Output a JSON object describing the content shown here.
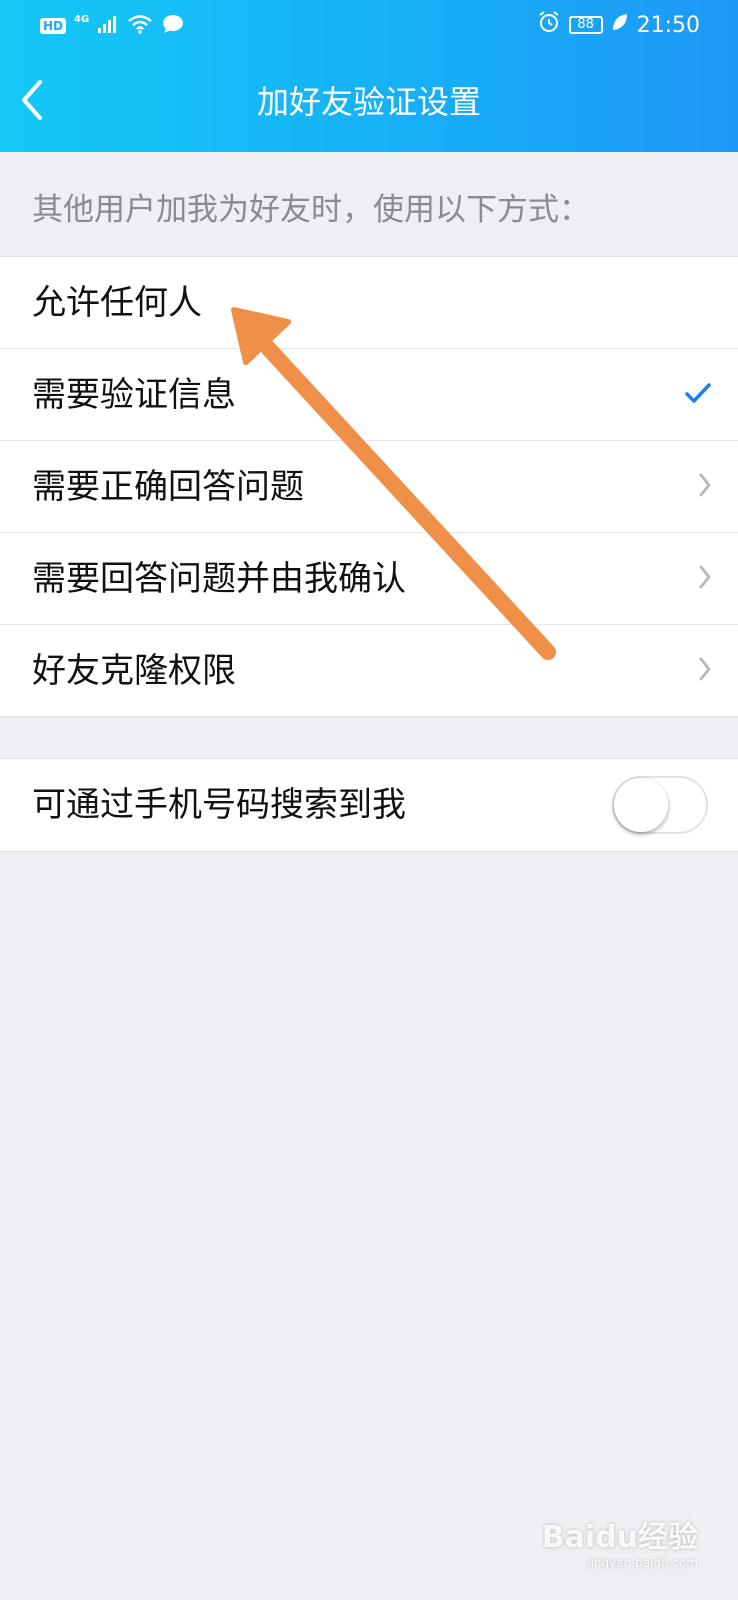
{
  "status_bar": {
    "hd": "HD",
    "network": "4G",
    "battery": "88",
    "time": "21:50"
  },
  "header": {
    "title": "加好友验证设置"
  },
  "section_hint": "其他用户加我为好友时，使用以下方式：",
  "options": [
    {
      "label": "允许任何人"
    },
    {
      "label": "需要验证信息"
    },
    {
      "label": "需要正确回答问题"
    },
    {
      "label": "需要回答问题并由我确认"
    },
    {
      "label": "好友克隆权限"
    }
  ],
  "phone_search": {
    "label": "可通过手机号码搜索到我",
    "enabled": false
  },
  "watermark": {
    "main": "Baidu经验",
    "url": "jingyan.baidu.com"
  },
  "colors": {
    "header_start": "#14c8f5",
    "header_end": "#1e98f7",
    "check": "#1a7ff2",
    "annotation_arrow": "#ef8f48"
  }
}
